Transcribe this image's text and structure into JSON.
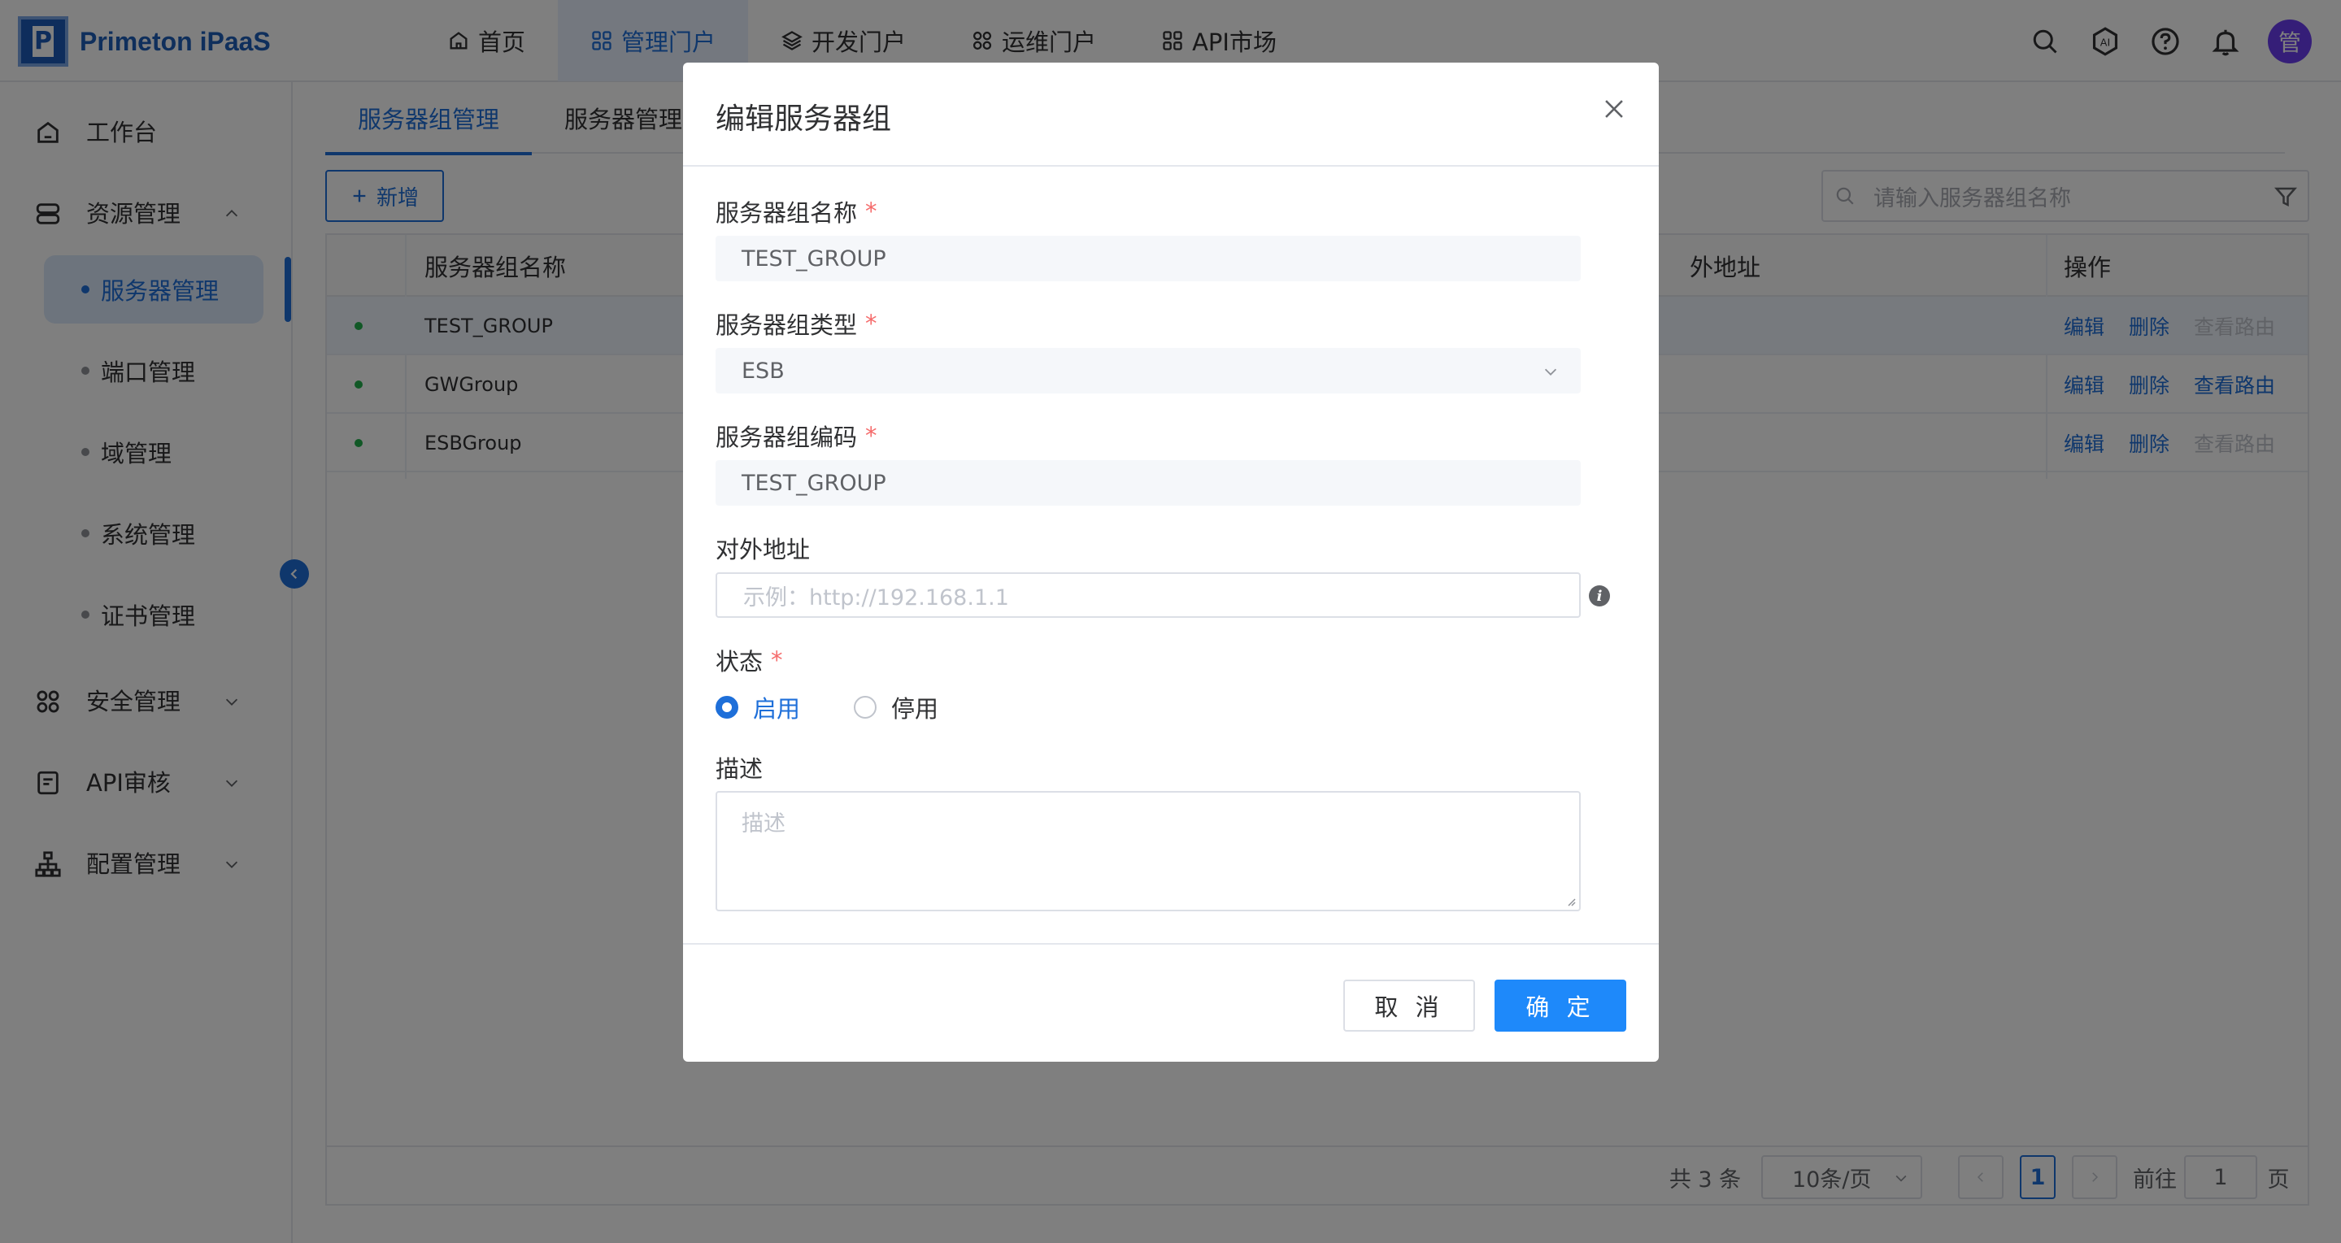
{
  "brand": {
    "name": "Primeton iPaaS"
  },
  "nav": {
    "items": [
      {
        "label": "首页",
        "icon": "home-icon"
      },
      {
        "label": "管理门户",
        "icon": "grid-icon",
        "active": true
      },
      {
        "label": "开发门户",
        "icon": "layers-icon"
      },
      {
        "label": "运维门户",
        "icon": "command-icon"
      },
      {
        "label": "API市场",
        "icon": "grid-icon"
      }
    ]
  },
  "header": {
    "icons": [
      "search-icon",
      "ai-icon",
      "help-icon",
      "bell-icon"
    ],
    "avatar": "管"
  },
  "sidebar": {
    "workbench": "工作台",
    "resource": "资源管理",
    "sub": [
      "服务器管理",
      "端口管理",
      "域管理",
      "系统管理",
      "证书管理"
    ],
    "security": "安全管理",
    "api_audit": "API审核",
    "config": "配置管理"
  },
  "main": {
    "tabs": [
      "服务器组管理",
      "服务器管理"
    ],
    "add_label": "新增",
    "search_placeholder": "请输入服务器组名称",
    "table": {
      "headers": [
        "服务器组名称",
        "外地址",
        "操作"
      ],
      "rows": [
        {
          "name": "TEST_GROUP",
          "ops": [
            "编辑",
            "删除",
            "查看路由"
          ],
          "route_enabled": false
        },
        {
          "name": "GWGroup",
          "ops": [
            "编辑",
            "删除",
            "查看路由"
          ],
          "route_enabled": true
        },
        {
          "name": "ESBGroup",
          "ops": [
            "编辑",
            "删除",
            "查看路由"
          ],
          "route_enabled": false
        }
      ]
    },
    "pager": {
      "total": "共 3 条",
      "page_size": "10条/页",
      "current": "1",
      "goto_prefix": "前往",
      "goto_value": "1",
      "goto_suffix": "页"
    }
  },
  "dialog": {
    "title": "编辑服务器组",
    "fields": {
      "name_label": "服务器组名称",
      "name_value": "TEST_GROUP",
      "type_label": "服务器组类型",
      "type_value": "ESB",
      "code_label": "服务器组编码",
      "code_value": "TEST_GROUP",
      "addr_label": "对外地址",
      "addr_placeholder": "示例：http://192.168.1.1",
      "status_label": "状态",
      "status_on": "启用",
      "status_off": "停用",
      "desc_label": "描述",
      "desc_placeholder": "描述"
    },
    "required_mark": "*",
    "info_glyph": "i",
    "cancel": "取 消",
    "ok": "确 定"
  },
  "colors": {
    "primary": "#1e6fd9",
    "button": "#1e89fa",
    "required": "#f56c6c",
    "status_ok": "#22b14c"
  }
}
